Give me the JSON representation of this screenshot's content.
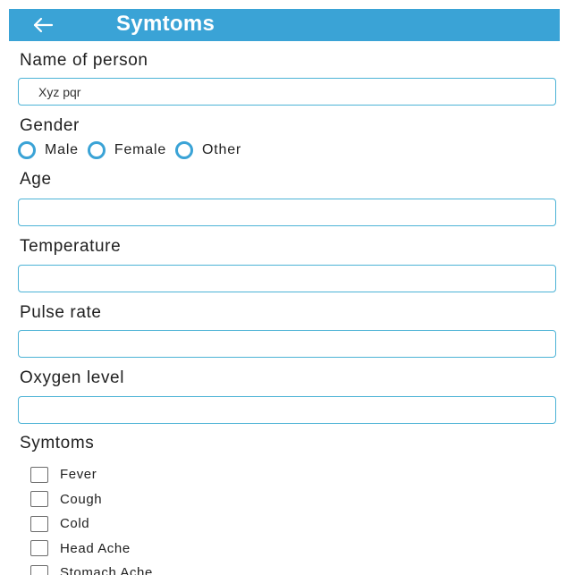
{
  "header": {
    "title": "Symtoms"
  },
  "form": {
    "name": {
      "label": "Name of person",
      "value": "Xyz pqr"
    },
    "gender": {
      "label": "Gender",
      "options": [
        "Male",
        "Female",
        "Other"
      ],
      "selected": null
    },
    "age": {
      "label": "Age",
      "value": ""
    },
    "temperature": {
      "label": "Temperature",
      "value": ""
    },
    "pulse": {
      "label": "Pulse rate",
      "value": ""
    },
    "oxygen": {
      "label": "Oxygen level",
      "value": ""
    },
    "symptoms": {
      "label": "Symtoms",
      "options": [
        "Fever",
        "Cough",
        "Cold",
        "Head Ache",
        "Stomach Ache"
      ]
    }
  },
  "colors": {
    "accent": "#3aa3d6",
    "field_border": "#4cb3d6",
    "text": "#212121"
  },
  "icons": {
    "back": "arrow-left-icon"
  }
}
